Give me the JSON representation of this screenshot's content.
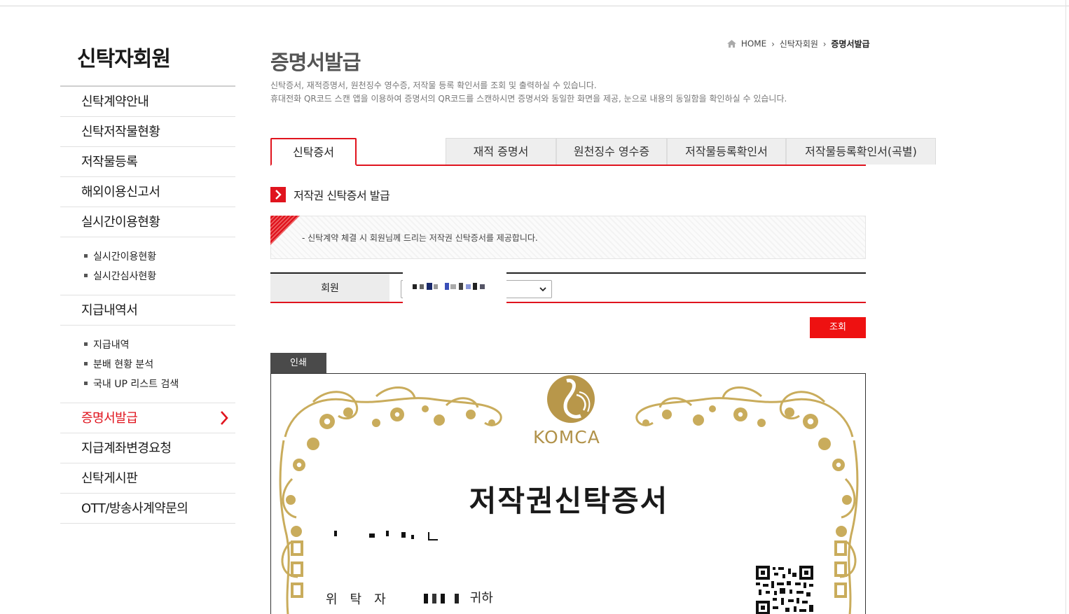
{
  "sidebar": {
    "title": "신탁자회원",
    "items": [
      {
        "label": "신탁계약안내"
      },
      {
        "label": "신탁저작물현황"
      },
      {
        "label": "저작물등록"
      },
      {
        "label": "해외이용신고서"
      },
      {
        "label": "실시간이용현황"
      },
      {
        "label": "지급내역서"
      },
      {
        "label": "증명서발급"
      },
      {
        "label": "지급계좌변경요청"
      },
      {
        "label": "신탁게시판"
      },
      {
        "label": "OTT/방송사계약문의"
      }
    ],
    "realtime_sub": [
      {
        "label": "실시간이용현황"
      },
      {
        "label": "실시간심사현황"
      }
    ],
    "payment_sub": [
      {
        "label": "지급내역"
      },
      {
        "label": "분배 현황 분석"
      },
      {
        "label": "국내 UP 리스트 검색"
      }
    ]
  },
  "breadcrumb": {
    "home": "HOME",
    "level1": "신탁자회원",
    "current": "증명서발급"
  },
  "header": {
    "title": "증명서발급",
    "desc_line1": "신탁증서, 재적증명서, 원천징수 영수증, 저작물 등록 확인서를 조회 및 출력하실 수 있습니다.",
    "desc_line2": "휴대전화 QR코드 스캔 앱을 이용하여 증명서의 QR코드를 스캔하시면 증명서와 동일한 화면을 제공, 눈으로 내용의 동일함을 확인하실 수 있습니다."
  },
  "tabs": [
    {
      "label": "신탁증서",
      "active": true
    },
    {
      "label": "재적 증명서",
      "active": false
    },
    {
      "label": "원천징수 영수증",
      "active": false
    },
    {
      "label": "저작물등록확인서",
      "active": false
    },
    {
      "label": "저작물등록확인서(곡별)",
      "active": false
    }
  ],
  "section": {
    "title": "저작권 신탁증서 발급",
    "notice": "- 신탁계약 체결 시 회원님께 드리는 저작권 신탁증서를 제공합니다."
  },
  "member": {
    "label": "회원"
  },
  "buttons": {
    "search": "조회",
    "print": "인쇄"
  },
  "certificate": {
    "brand": "KOMCA",
    "title": "저작권신탁증서",
    "trustor_label": "위탁자",
    "trustor_value_suffix": "귀하"
  },
  "colors": {
    "accent": "#e0141e",
    "gold": "#b1924a"
  }
}
